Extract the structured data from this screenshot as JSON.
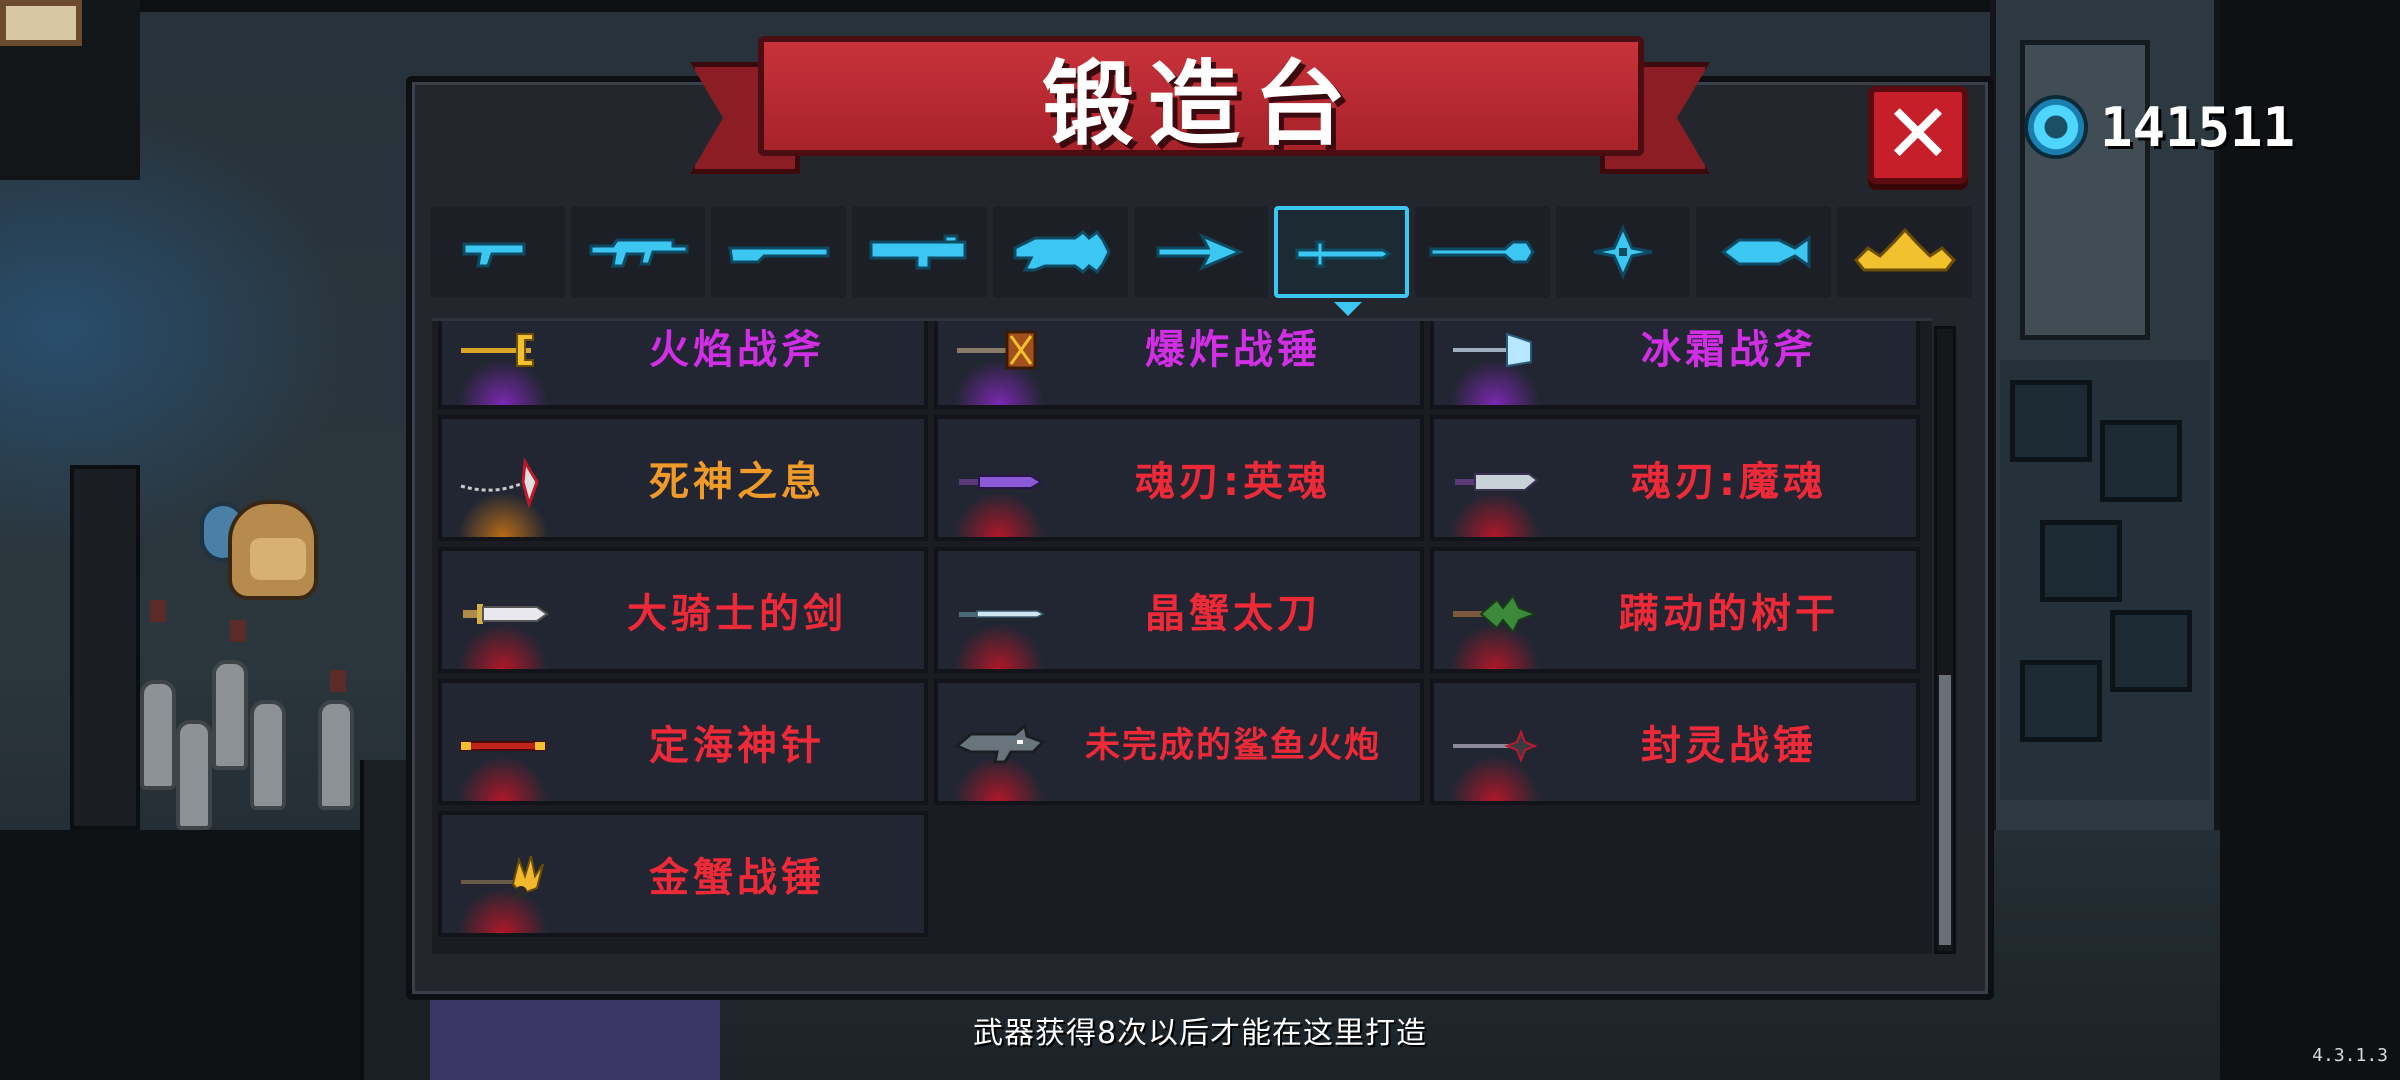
{
  "title": "锻造台",
  "close_button": {
    "label": "✕",
    "icon": "close-icon"
  },
  "currency": {
    "icon": "gem-icon",
    "value": "141511"
  },
  "tabs": [
    {
      "name": "pistol",
      "icon": "pistol-icon",
      "color": "#3cc7f2",
      "selected": false
    },
    {
      "name": "rifle",
      "icon": "rifle-icon",
      "color": "#3cc7f2",
      "selected": false
    },
    {
      "name": "shotgun",
      "icon": "shotgun-icon",
      "color": "#3cc7f2",
      "selected": false
    },
    {
      "name": "launcher",
      "icon": "launcher-icon",
      "color": "#3cc7f2",
      "selected": false
    },
    {
      "name": "laser",
      "icon": "laser-icon",
      "color": "#3cc7f2",
      "selected": false
    },
    {
      "name": "bow",
      "icon": "bow-icon",
      "color": "#3cc7f2",
      "selected": false
    },
    {
      "name": "sword",
      "icon": "sword-icon",
      "color": "#3cc7f2",
      "selected": true
    },
    {
      "name": "spear",
      "icon": "spear-icon",
      "color": "#3cc7f2",
      "selected": false
    },
    {
      "name": "throwing-star",
      "icon": "shuriken-icon",
      "color": "#3cc7f2",
      "selected": false
    },
    {
      "name": "fish",
      "icon": "fish-icon",
      "color": "#3cc7f2",
      "selected": false
    },
    {
      "name": "special",
      "icon": "crown-icon",
      "color": "#f2c12e",
      "selected": false
    }
  ],
  "weapons": [
    {
      "name": "火焰战斧",
      "rarity_color": "purple",
      "icon": "flame-axe-icon"
    },
    {
      "name": "爆炸战锤",
      "rarity_color": "purple",
      "icon": "explosive-hammer-icon"
    },
    {
      "name": "冰霜战斧",
      "rarity_color": "purple",
      "icon": "frost-axe-icon"
    },
    {
      "name": "死神之息",
      "rarity_color": "orange",
      "icon": "scythe-icon"
    },
    {
      "name": "魂刃:英魂",
      "rarity_color": "red",
      "icon": "soul-blade-icon"
    },
    {
      "name": "魂刃:魔魂",
      "rarity_color": "red",
      "icon": "demon-blade-icon"
    },
    {
      "name": "大骑士的剑",
      "rarity_color": "red",
      "icon": "knight-sword-icon"
    },
    {
      "name": "晶蟹太刀",
      "rarity_color": "red",
      "icon": "crystal-katana-icon"
    },
    {
      "name": "蹒动的树干",
      "rarity_color": "red",
      "icon": "tree-trunk-icon"
    },
    {
      "name": "定海神针",
      "rarity_color": "red",
      "icon": "golden-staff-icon"
    },
    {
      "name": "未完成的鲨鱼火炮",
      "rarity_color": "red",
      "icon": "shark-cannon-icon"
    },
    {
      "name": "封灵战锤",
      "rarity_color": "red",
      "icon": "seal-hammer-icon"
    },
    {
      "name": "金蟹战锤",
      "rarity_color": "red",
      "icon": "golden-crab-hammer-icon"
    }
  ],
  "colors": {
    "purple": "#d12ee6",
    "orange": "#f09a2a",
    "red": "#ee2a38",
    "tab_accent": "#3cc7f2",
    "banner": "#b8262f"
  },
  "scroll_position": 0.55,
  "hint": "武器获得8次以后才能在这里打造",
  "version": "4.3.1.3"
}
